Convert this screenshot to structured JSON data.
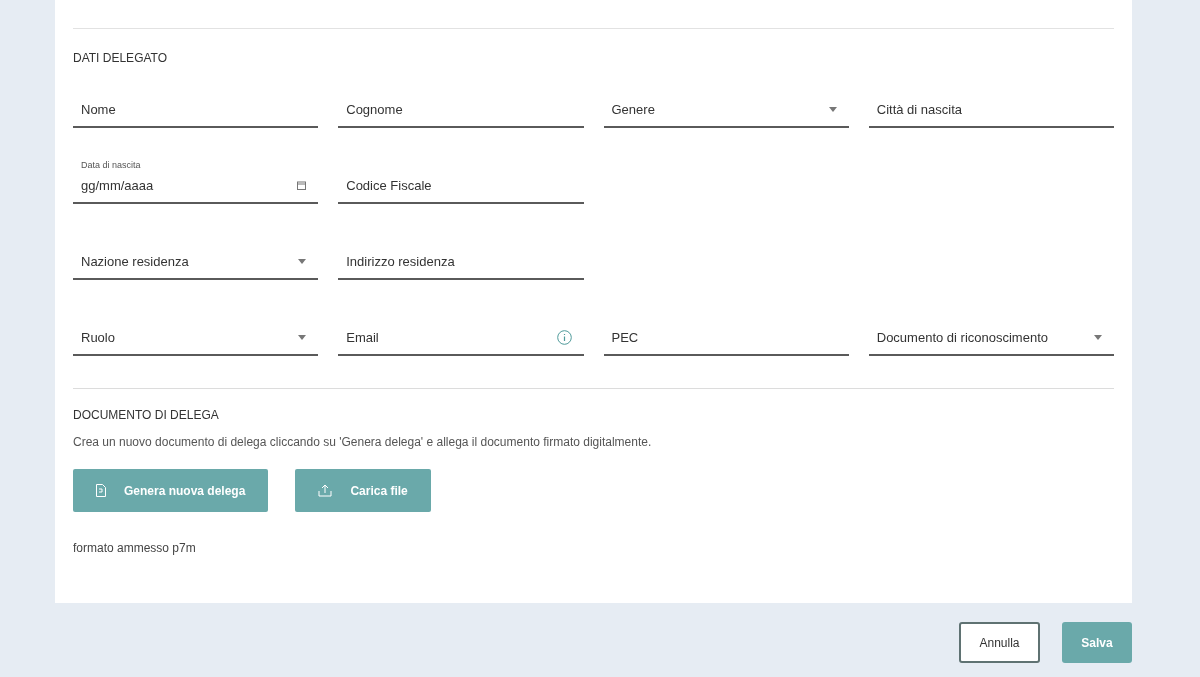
{
  "section_title": "DATI DELEGATO",
  "field_rows": [
    [
      {
        "kind": "text",
        "placeholder": "Nome"
      },
      {
        "kind": "text",
        "placeholder": "Cognome"
      },
      {
        "kind": "select",
        "placeholder": "Genere"
      },
      {
        "kind": "text",
        "placeholder": "Città di nascita"
      }
    ],
    [
      {
        "kind": "date",
        "label": "Data di nascita",
        "placeholder": "gg/mm/aaaa"
      },
      {
        "kind": "text",
        "placeholder": "Codice Fiscale"
      }
    ],
    [
      {
        "kind": "select",
        "placeholder": "Nazione residenza"
      },
      {
        "kind": "text",
        "placeholder": "Indirizzo residenza"
      }
    ],
    [
      {
        "kind": "select",
        "placeholder": "Ruolo"
      },
      {
        "kind": "info",
        "placeholder": "Email"
      },
      {
        "kind": "text",
        "placeholder": "PEC"
      },
      {
        "kind": "select",
        "placeholder": "Documento di riconoscimento"
      }
    ]
  ],
  "document": {
    "title": "DOCUMENTO DI DELEGA",
    "description": "Crea un nuovo documento di delega cliccando su 'Genera delega' e allega il documento firmato digitalmente.",
    "buttons": [
      {
        "kind": "generate",
        "label": "Genera nuova delega"
      },
      {
        "kind": "upload",
        "label": "Carica file"
      }
    ],
    "note": "formato ammesso p7m"
  },
  "footer_buttons": [
    {
      "kind": "secondary",
      "label": "Annulla"
    },
    {
      "kind": "primary",
      "label": "Salva"
    }
  ]
}
